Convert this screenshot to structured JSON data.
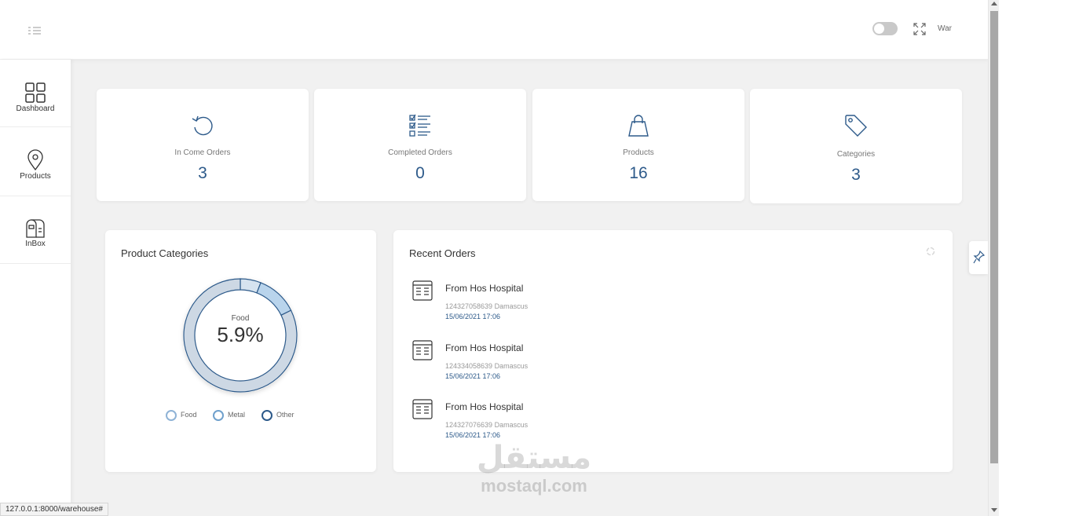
{
  "header": {
    "user_label": "War"
  },
  "sidebar": {
    "items": [
      {
        "label": "Dashboard",
        "icon": "grid-icon"
      },
      {
        "label": "Products",
        "icon": "location-pin-icon"
      },
      {
        "label": "InBox",
        "icon": "mailbox-icon"
      }
    ]
  },
  "stats": [
    {
      "label": "In Come Orders",
      "value": "3",
      "icon": "refresh-icon"
    },
    {
      "label": "Completed Orders",
      "value": "0",
      "icon": "checklist-icon"
    },
    {
      "label": "Products",
      "value": "16",
      "icon": "shopping-bag-icon"
    },
    {
      "label": "Categories",
      "value": "3",
      "icon": "tag-icon"
    }
  ],
  "categories_panel": {
    "title": "Product Categories",
    "center_label": "Food",
    "center_value": "5.9%",
    "legend": [
      "Food",
      "Metal",
      "Other"
    ]
  },
  "chart_data": {
    "type": "pie",
    "categories": [
      "Food",
      "Metal",
      "Other"
    ],
    "values": [
      5.9,
      11.8,
      82.3
    ],
    "colors": [
      "#d6e3ef",
      "#b9d4ec",
      "#cdd8e4"
    ],
    "title": "Product Categories"
  },
  "orders_panel": {
    "title": "Recent Orders",
    "orders": [
      {
        "title": "From Hos Hospital",
        "sub": "124327058639 Damascus",
        "date": "15/06/2021 17:06"
      },
      {
        "title": "From Hos Hospital",
        "sub": "124334058639 Damascus",
        "date": "15/06/2021 17:06"
      },
      {
        "title": "From Hos Hospital",
        "sub": "124327076639 Damascus",
        "date": "15/06/2021 17:06"
      }
    ]
  },
  "watermark": {
    "arabic": "مستقل",
    "latin": "mostaql.com"
  },
  "status_url": "127.0.0.1:8000/warehouse#",
  "colors": {
    "accent": "#2d5a8a",
    "background": "#f1f1f1"
  }
}
